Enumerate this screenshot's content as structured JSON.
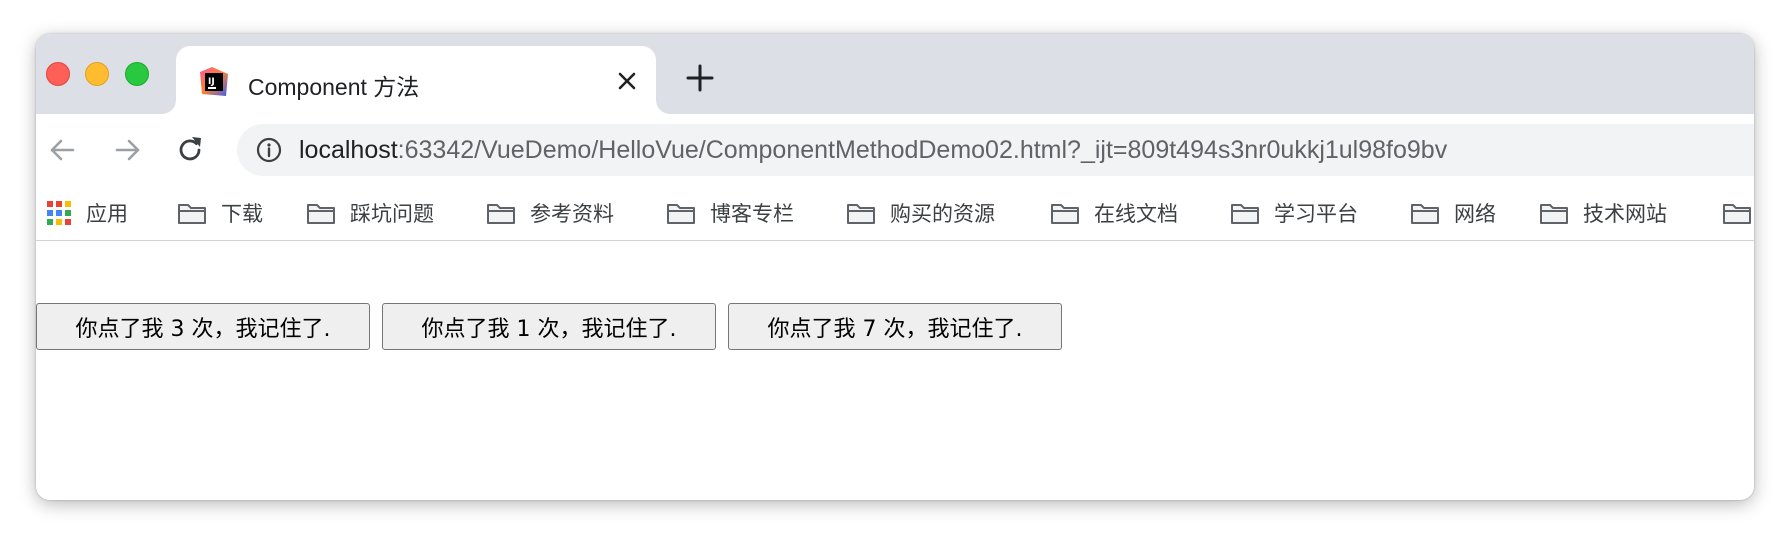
{
  "tab": {
    "title": "Component 方法",
    "favicon": "intellij-idea-icon"
  },
  "toolbar": {
    "url_host": "localhost",
    "url_rest": ":63342/VueDemo/HelloVue/ComponentMethodDemo02.html?_ijt=809t494s3nr0ukkj1ul98fo9bv"
  },
  "bookmarks": {
    "apps_label": "应用",
    "items": [
      {
        "label": "下载"
      },
      {
        "label": "踩坑问题"
      },
      {
        "label": "参考资料"
      },
      {
        "label": "博客专栏"
      },
      {
        "label": "购买的资源"
      },
      {
        "label": "在线文档"
      },
      {
        "label": "学习平台"
      },
      {
        "label": "网络"
      },
      {
        "label": "技术网站"
      }
    ]
  },
  "page": {
    "buttons": [
      {
        "label": "你点了我 3 次，我记住了."
      },
      {
        "label": "你点了我 1 次，我记住了."
      },
      {
        "label": "你点了我 7 次，我记住了."
      }
    ]
  },
  "colors": {
    "tabstrip": "#dcdfe6",
    "omnibox": "#f1f3f4",
    "traffic_red": "#fe5f57",
    "traffic_yellow": "#febc2e",
    "traffic_green": "#28c840",
    "button_bg": "#efefef"
  }
}
